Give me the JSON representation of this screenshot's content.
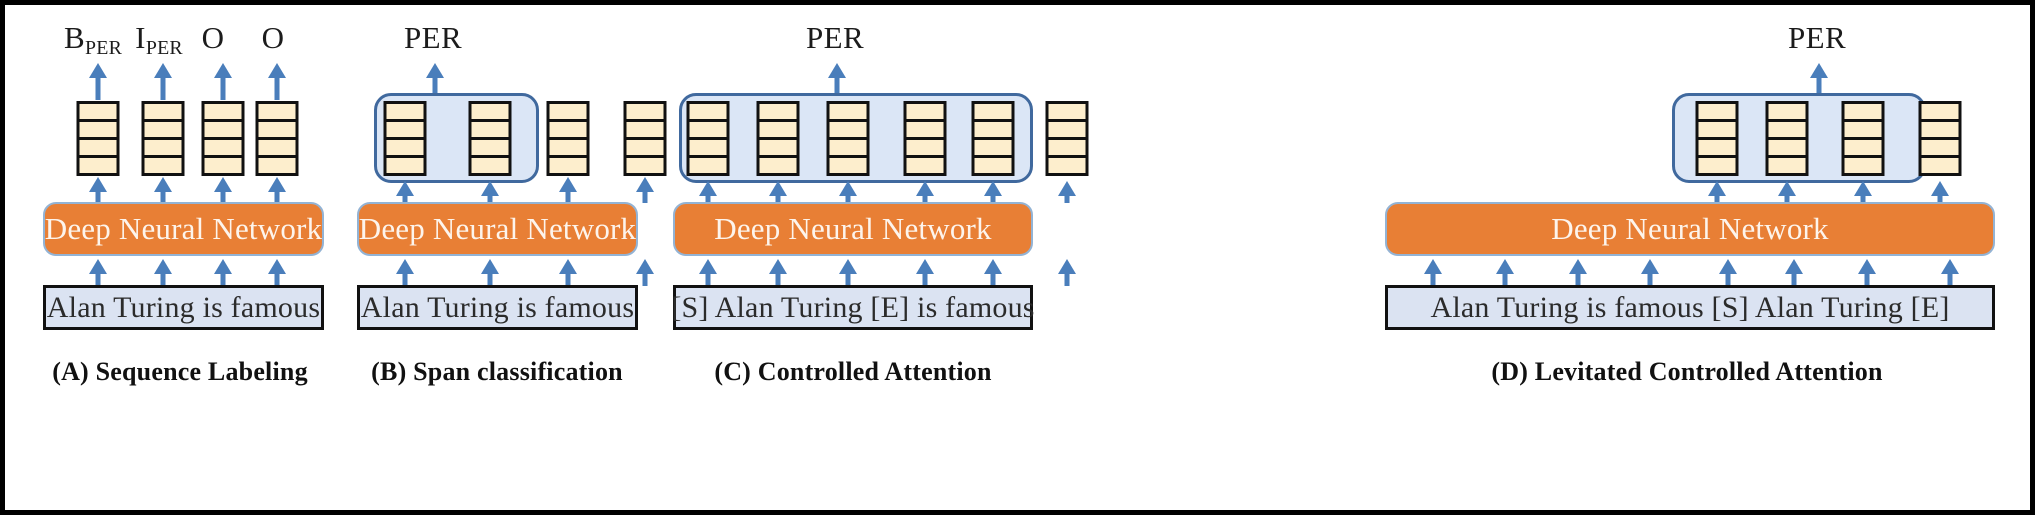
{
  "figure": {
    "background": "#ffffff",
    "border_color": "#000000",
    "colors": {
      "arrow_blue": "#4a7ebb",
      "vector_fill": "#fdeecd",
      "vector_border": "#111111",
      "group_box_fill": "#dbe6f6",
      "group_box_border": "#40699e",
      "dnn_fill": "#e87f35",
      "dnn_border": "#93b3d4",
      "dnn_text": "#fdf4ec",
      "sentence_fill": "#dbe3f2",
      "sentence_border": "#111111",
      "text": "#1c1c1c"
    }
  },
  "panels": [
    {
      "id": "A",
      "caption": "(A) Sequence Labeling",
      "encoder_label": "Deep Neural Network",
      "sentence": "Alan Turing   is  famous",
      "output_tags": [
        {
          "main": "B",
          "sub": "PER"
        },
        {
          "main": "I",
          "sub": "PER"
        },
        {
          "main": "O",
          "sub": ""
        },
        {
          "main": "O",
          "sub": ""
        }
      ],
      "vector_count": 4,
      "vector_cells": 4,
      "grouped_vector_indices": [],
      "input_arrow_count": 4
    },
    {
      "id": "B",
      "caption": "(B) Span classification",
      "encoder_label": "Deep Neural Network",
      "sentence": "Alan Turing   is  famous",
      "output_tags": [
        {
          "main": "PER",
          "sub": ""
        }
      ],
      "vector_count": 4,
      "vector_cells": 4,
      "grouped_vector_indices": [
        0,
        1
      ],
      "input_arrow_count": 4
    },
    {
      "id": "C",
      "caption": "(C) Controlled Attention",
      "encoder_label": "Deep Neural Network",
      "sentence": "[S] Alan Turing  [E]  is  famous",
      "output_tags": [
        {
          "main": "PER",
          "sub": ""
        }
      ],
      "vector_count": 6,
      "vector_cells": 4,
      "grouped_vector_indices": [
        0,
        1,
        2,
        3,
        4,
        5
      ],
      "input_arrow_count": 6
    },
    {
      "id": "D",
      "caption": "(D) Levitated Controlled Attention",
      "encoder_label": "Deep Neural Network",
      "sentence": "Alan Turing is famous [S] Alan Turing [E]",
      "output_tags": [
        {
          "main": "PER",
          "sub": ""
        }
      ],
      "vector_count": 4,
      "vector_cells": 4,
      "grouped_vector_indices": [
        0,
        1,
        2,
        3
      ],
      "input_arrow_count": 8
    }
  ]
}
